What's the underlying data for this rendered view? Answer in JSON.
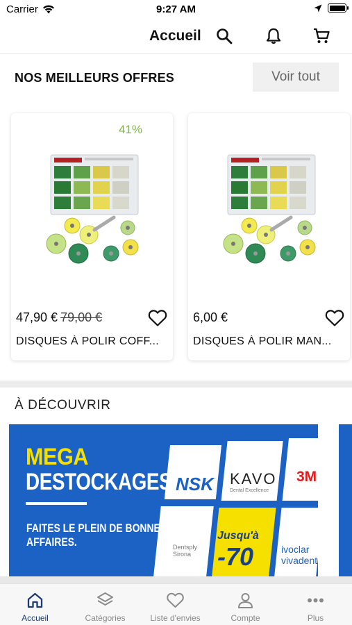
{
  "status_bar": {
    "carrier": "Carrier",
    "time": "9:27 AM"
  },
  "header": {
    "title": "Accueil",
    "icons": [
      "search-icon",
      "bell-icon",
      "cart-icon"
    ]
  },
  "offers": {
    "title": "NOS MEILLEURS OFFRES",
    "see_all_label": "Voir tout",
    "products": [
      {
        "discount": "41%",
        "price": "47,90 €",
        "old_price": "79,00 €",
        "name": "DISQUES À POLIR COFF..."
      },
      {
        "discount": "",
        "price": "6,00 €",
        "old_price": "",
        "name": "DISQUES À POLIR MAN..."
      }
    ]
  },
  "discover": {
    "title": "À DÉCOUVRIR",
    "banner": {
      "headline_1": "MEGA",
      "headline_2": "DESTOCKAGES",
      "tagline_1": "FAITES LE PLEIN DE BONNES",
      "tagline_2": "AFFAIRES.",
      "brands": [
        "NSK",
        "KAVO",
        "3M",
        "Dentsply Sirona",
        "ivoclar vivadent"
      ],
      "kavo_sub": "Dental Excellence",
      "promo_1": "Jusqu'à",
      "promo_2": "-70"
    }
  },
  "tab_bar": {
    "items": [
      {
        "label": "Accueil",
        "icon": "home-icon"
      },
      {
        "label": "Catégories",
        "icon": "layers-icon"
      },
      {
        "label": "Liste d'envies",
        "icon": "heart-icon"
      },
      {
        "label": "Compte",
        "icon": "user-icon"
      },
      {
        "label": "Plus",
        "icon": "more-icon"
      }
    ]
  },
  "colors": {
    "accent": "#1e3d6e",
    "discount": "#7db93b",
    "banner_blue": "#1b62c4",
    "banner_yellow": "#f5e000"
  }
}
